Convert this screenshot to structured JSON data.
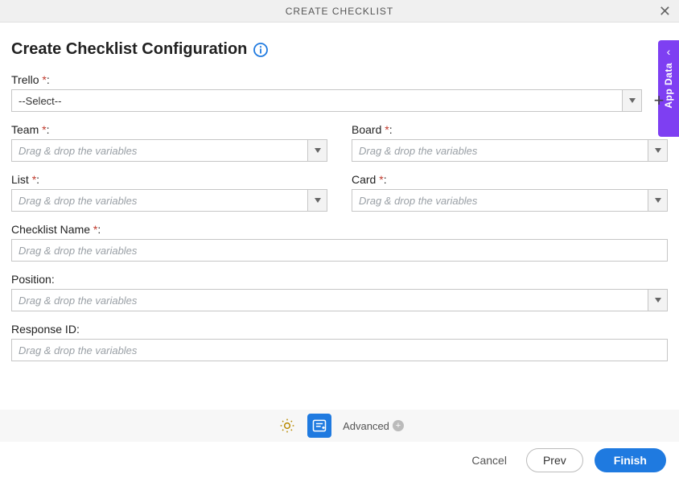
{
  "header": {
    "title": "CREATE CHECKLIST"
  },
  "page": {
    "title": "Create Checklist Configuration"
  },
  "sidebar": {
    "app_data_label": "App Data"
  },
  "fields": {
    "trello": {
      "label": "Trello",
      "required_marker": "*",
      "colon": ":",
      "selected": "--Select--"
    },
    "team": {
      "label": "Team",
      "required_marker": "*",
      "colon": ":",
      "placeholder": "Drag & drop the variables"
    },
    "board": {
      "label": "Board",
      "required_marker": "*",
      "colon": ":",
      "placeholder": "Drag & drop the variables"
    },
    "list": {
      "label": "List",
      "required_marker": "*",
      "colon": ":",
      "placeholder": "Drag & drop the variables"
    },
    "card": {
      "label": "Card",
      "required_marker": "*",
      "colon": ":",
      "placeholder": "Drag & drop the variables"
    },
    "checklist_name": {
      "label": "Checklist Name",
      "required_marker": "*",
      "colon": ":",
      "placeholder": "Drag & drop the variables"
    },
    "position": {
      "label": "Position",
      "colon": ":",
      "placeholder": "Drag & drop the variables"
    },
    "response_id": {
      "label": "Response ID",
      "colon": ":",
      "placeholder": "Drag & drop the variables"
    }
  },
  "toolbar": {
    "advanced_label": "Advanced"
  },
  "footer": {
    "cancel": "Cancel",
    "prev": "Prev",
    "finish": "Finish"
  }
}
